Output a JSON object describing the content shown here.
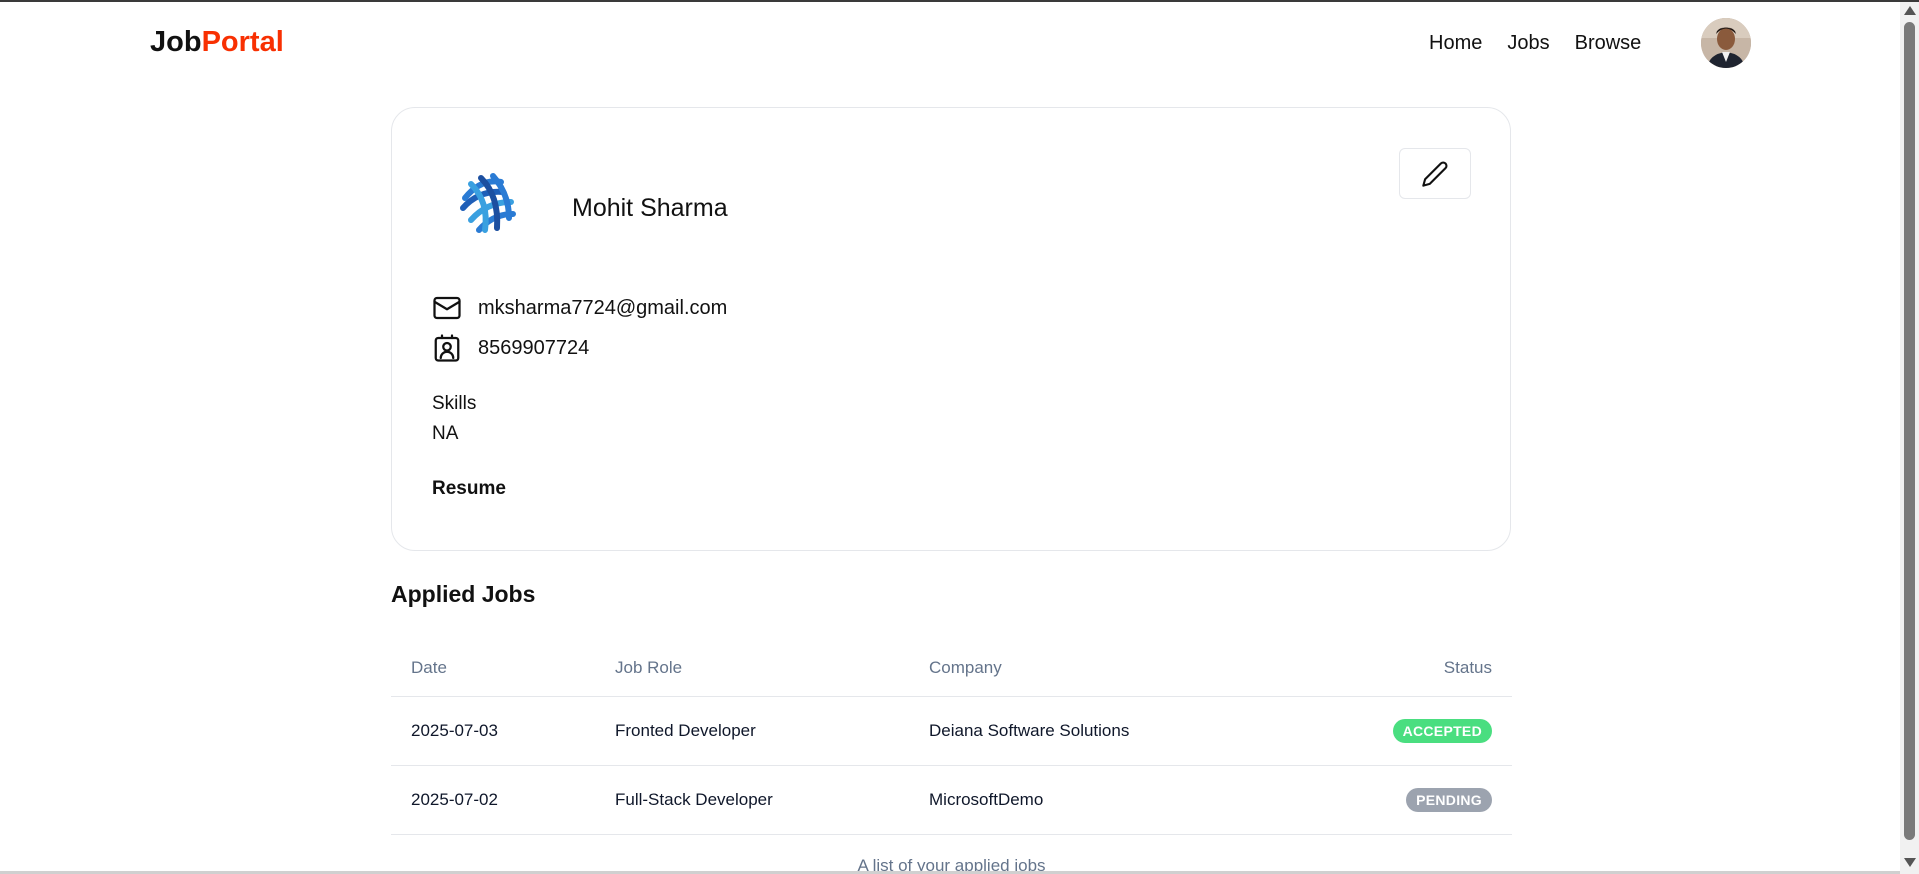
{
  "navbar": {
    "logo_part1": "Job",
    "logo_part2": "Portal",
    "links": [
      "Home",
      "Jobs",
      "Browse"
    ]
  },
  "profile": {
    "name": "Mohit Sharma",
    "email": "mksharma7724@gmail.com",
    "phone": "8569907724",
    "skills_label": "Skills",
    "skills_value": "NA",
    "resume_label": "Resume"
  },
  "applied": {
    "title": "Applied Jobs",
    "headers": [
      "Date",
      "Job Role",
      "Company",
      "Status"
    ],
    "rows": [
      {
        "date": "2025-07-03",
        "role": "Fronted Developer",
        "company": "Deiana Software Solutions",
        "status": "ACCEPTED",
        "status_color": "#4ade80"
      },
      {
        "date": "2025-07-02",
        "role": "Full-Stack Developer",
        "company": "MicrosoftDemo",
        "status": "PENDING",
        "status_color": "#9ca3af"
      }
    ],
    "caption": "A list of your applied jobs"
  },
  "colors": {
    "brand_accent": "#f83002",
    "accepted": "#4ade80",
    "pending": "#9ca3af"
  },
  "icons": {
    "edit": "pen-icon",
    "email": "mail-icon",
    "phone": "contact-icon"
  }
}
